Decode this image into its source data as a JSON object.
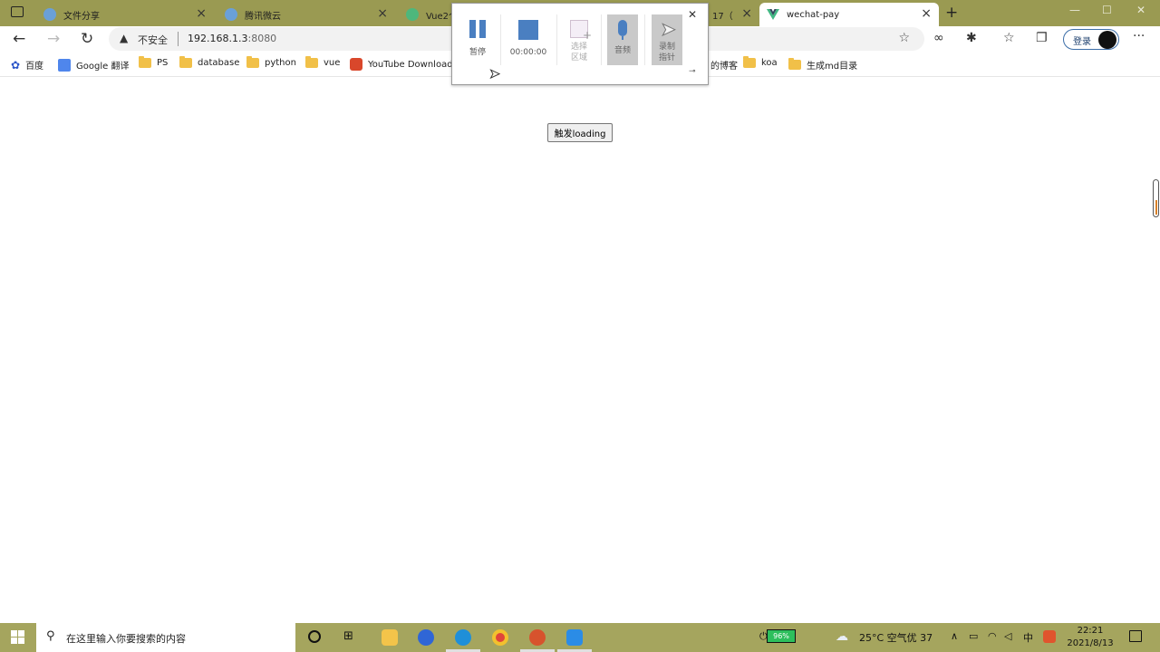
{
  "tabs": [
    {
      "title": "文件分享"
    },
    {
      "title": "腾讯微云"
    },
    {
      "title": "Vue2个"
    },
    {
      "title": "17（"
    },
    {
      "title": "wechat-pay"
    }
  ],
  "window_controls": {
    "minimize": "—",
    "maximize": "☐",
    "close": "✕"
  },
  "new_tab": "+",
  "address": {
    "insecure_label": "不安全",
    "host": "192.168.1.3",
    "port": ":8080"
  },
  "toolbar": {
    "login_label": "登录"
  },
  "bookmarks": [
    {
      "label": "百度",
      "kind": "paw"
    },
    {
      "label": "Google 翻译",
      "kind": "google"
    },
    {
      "label": "PS",
      "kind": "folder"
    },
    {
      "label": "database",
      "kind": "folder"
    },
    {
      "label": "python",
      "kind": "folder"
    },
    {
      "label": "vue",
      "kind": "folder"
    },
    {
      "label": "YouTube Download...",
      "kind": "youtube"
    },
    {
      "label": "的博客",
      "kind": "none"
    },
    {
      "label": "koa",
      "kind": "folder"
    },
    {
      "label": "生成md目录",
      "kind": "folder"
    }
  ],
  "page": {
    "trigger_button": "触发loading"
  },
  "recorder": {
    "pause_label": "暂停",
    "timer": "00:00:00",
    "region_label": "选择区域",
    "audio_label": "音频",
    "pointer_label": "录制指针"
  },
  "taskbar": {
    "search_placeholder": "在这里输入你要搜索的内容",
    "battery": "96%",
    "weather": "25°C 空气优 37",
    "ime": "中",
    "time": "22:21",
    "date": "2021/8/13"
  },
  "colors": {
    "tab_strip": "#9a9a52",
    "taskbar": "#a5a55e",
    "recorder_accent": "#4a7fc1"
  }
}
